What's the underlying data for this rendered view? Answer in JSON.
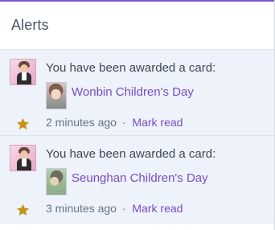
{
  "header": {
    "title": "Alerts"
  },
  "alerts": [
    {
      "message": "You have been awarded a card:",
      "card_name": "Wonbin Children's Day",
      "time": "2 minutes ago",
      "separator": "·",
      "action": "Mark read",
      "icon": "star-icon"
    },
    {
      "message": "You have been awarded a card:",
      "card_name": "Seunghan Children's Day",
      "time": "3 minutes ago",
      "separator": "·",
      "action": "Mark read",
      "icon": "star-icon"
    }
  ],
  "colors": {
    "accent": "#7a4cc2",
    "top_border": "#7e57c2",
    "alert_background": "#edf2fb",
    "star": "#c79316",
    "text": "#3f4656",
    "muted": "#697386"
  }
}
